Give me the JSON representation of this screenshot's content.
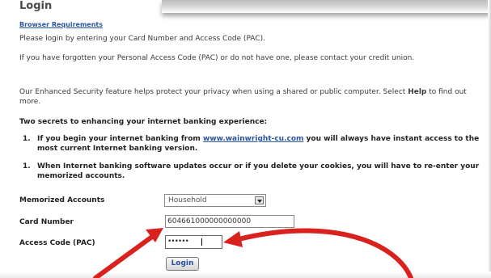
{
  "page": {
    "title": "Login",
    "browser_requirements_link": "Browser Requirements",
    "intro_text": "Please login by entering your Card Number and Access Code (PAC).",
    "forgot_text": "If you have forgotten your Personal Access Code (PAC) or do not have one, please contact your credit union.",
    "security_text_before": "Our Enhanced Security feature helps protect your privacy when using a shared or public computer. Select ",
    "security_help_word": "Help",
    "security_text_after": " to find out more.",
    "secrets_heading": "Two secrets to enhancing your internet banking experience:",
    "list": [
      {
        "number": "1.",
        "text_before_link": "If you begin your internet banking from ",
        "link": "www.wainwright-cu.com",
        "text_after_link": " you will always have instant access to the most current Internet banking version."
      },
      {
        "number": "1.",
        "text": "When Internet banking software updates occur or if you delete your cookies, you will have to re-enter your memorized accounts."
      }
    ]
  },
  "form": {
    "memorized_label": "Memorized Accounts",
    "memorized_value": "Household",
    "card_label": "Card Number",
    "card_value": "604661000000000000",
    "pac_label": "Access Code (PAC)",
    "pac_value": "••••••",
    "login_button": "Login"
  },
  "colors": {
    "link": "#2a55a3",
    "arrow": "#d9211e"
  },
  "icons": {
    "select_arrow": "chevron-down-icon"
  }
}
